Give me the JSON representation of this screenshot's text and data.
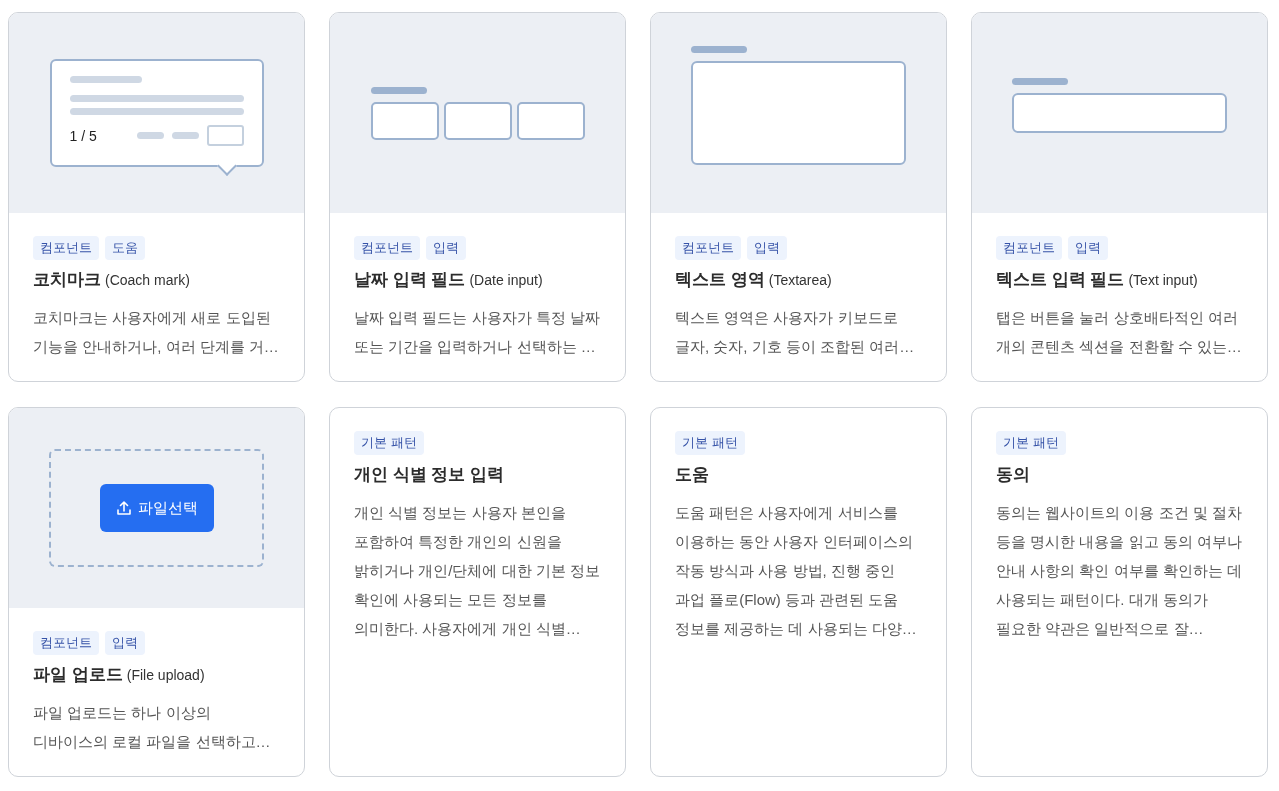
{
  "cards": [
    {
      "preview": {
        "kind": "coach",
        "counter": "1 / 5"
      },
      "tags": [
        "컴포넌트",
        "도움"
      ],
      "title": "코치마크",
      "title_en": "(Coach mark)",
      "description": [
        "코치마크는 사용자에게 새로 도입된",
        "기능을 안내하거나, 여러 단계를 거…"
      ]
    },
    {
      "preview": {
        "kind": "date"
      },
      "tags": [
        "컴포넌트",
        "입력"
      ],
      "title": "날짜 입력 필드",
      "title_en": "(Date input)",
      "description": [
        "날짜 입력 필드는 사용자가 특정 날짜",
        "또는 기간을 입력하거나 선택하는 …"
      ]
    },
    {
      "preview": {
        "kind": "textarea"
      },
      "tags": [
        "컴포넌트",
        "입력"
      ],
      "title": "텍스트 영역",
      "title_en": "(Textarea)",
      "description": [
        "텍스트 영역은 사용자가 키보드로",
        "글자, 숫자, 기호 등이 조합된 여러…"
      ]
    },
    {
      "preview": {
        "kind": "textinput"
      },
      "tags": [
        "컴포넌트",
        "입력"
      ],
      "title": "텍스트 입력 필드",
      "title_en": "(Text input)",
      "description": [
        "탭은 버튼을 눌러 상호배타적인 여러",
        "개의 콘텐츠 섹션을 전환할 수 있는…"
      ]
    },
    {
      "preview": {
        "kind": "upload",
        "button": "파일선택"
      },
      "tags": [
        "컴포넌트",
        "입력"
      ],
      "title": "파일 업로드",
      "title_en": "(File upload)",
      "description": [
        "파일 업로드는 하나 이상의",
        "디바이스의 로컬 파일을 선택하고…"
      ]
    },
    {
      "tags": [
        "기본 패턴"
      ],
      "title": "개인 식별 정보 입력",
      "description": [
        "개인 식별 정보는 사용자 본인을",
        "포함하여 특정한 개인의 신원을",
        "밝히거나 개인/단체에 대한 기본 정보",
        "확인에 사용되는 모든 정보를",
        "의미한다. 사용자에게 개인 식별…"
      ]
    },
    {
      "tags": [
        "기본 패턴"
      ],
      "title": "도움",
      "description": [
        "도움 패턴은 사용자에게 서비스를",
        "이용하는 동안 사용자 인터페이스의",
        "작동 방식과 사용 방법, 진행 중인",
        "과업 플로(Flow) 등과 관련된 도움",
        "정보를 제공하는 데 사용되는 다양…"
      ]
    },
    {
      "tags": [
        "기본 패턴"
      ],
      "title": "동의",
      "description": [
        "동의는 웹사이트의 이용 조건 및 절차",
        "등을 명시한 내용을 읽고 동의 여부나",
        "안내 사항의 확인 여부를 확인하는 데",
        "사용되는 패턴이다. 대개 동의가",
        "필요한 약관은 일반적으로 잘…"
      ]
    }
  ]
}
